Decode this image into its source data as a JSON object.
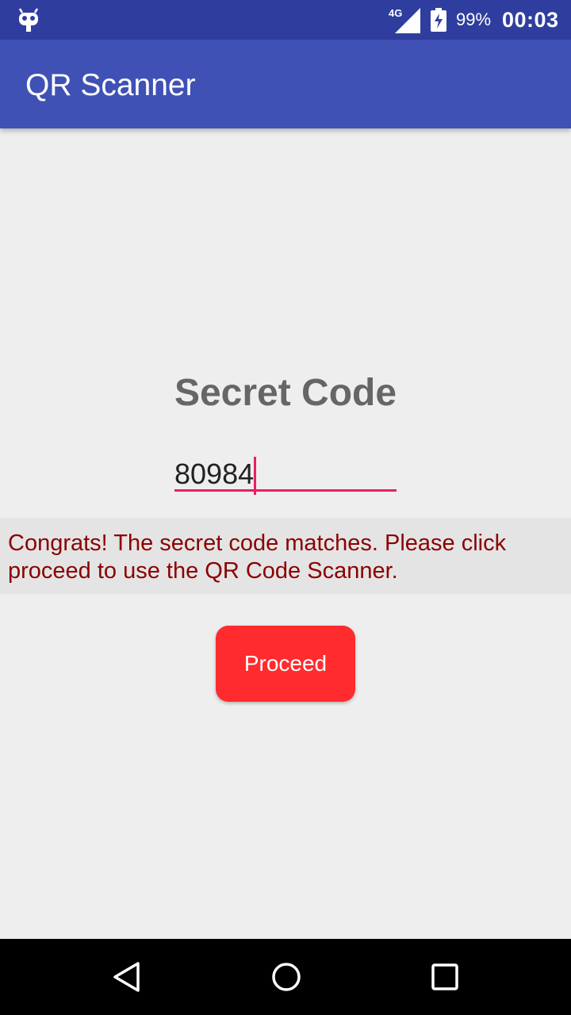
{
  "status_bar": {
    "network_label": "4G",
    "battery_percent": "99%",
    "time": "00:03"
  },
  "app_bar": {
    "title": "QR Scanner"
  },
  "main": {
    "heading": "Secret Code",
    "code_input_value": "80984",
    "message": "Congrats! The secret code matches. Please click proceed to use the QR Code Scanner.",
    "proceed_label": "Proceed"
  },
  "icons": {
    "status_left": "android-robot-icon",
    "signal": "cell-signal-icon",
    "battery": "battery-charging-icon",
    "nav_back": "back-triangle-icon",
    "nav_home": "home-circle-icon",
    "nav_recents": "recents-square-icon"
  },
  "colors": {
    "status_bar": "#2f3e9e",
    "app_bar": "#3f51b5",
    "accent": "#e91e63",
    "message_text": "#8b0000",
    "proceed_button": "#ff2b2e",
    "background": "#eeeeee"
  }
}
